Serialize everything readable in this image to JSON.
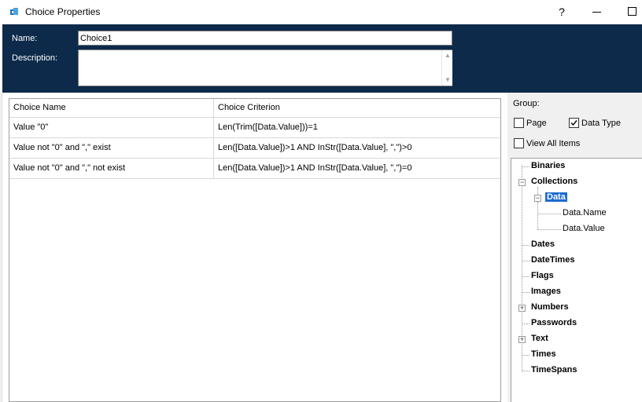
{
  "window": {
    "title": "Choice Properties",
    "help_glyph": "?",
    "icon": "app-icon"
  },
  "header": {
    "name_label": "Name:",
    "name_value": "Choice1",
    "description_label": "Description:",
    "description_value": "",
    "colors": {
      "panel_bg": "#0d2a4a"
    }
  },
  "grid": {
    "columns": [
      "Choice Name",
      "Choice Criterion"
    ],
    "rows": [
      {
        "name": "Value \"0\"",
        "criterion": "Len(Trim([Data.Value]))=1"
      },
      {
        "name": "Value not \"0\" and \",\" exist",
        "criterion": "Len([Data.Value])>1 AND InStr([Data.Value], \",\")>0"
      },
      {
        "name": "Value not \"0\" and \",\" not exist",
        "criterion": "Len([Data.Value])>1 AND InStr([Data.Value], \",\")=0"
      }
    ]
  },
  "group": {
    "label": "Group:",
    "page_label": "Page",
    "page_checked": false,
    "data_type_label": "Data Type",
    "data_type_checked": true,
    "view_all_label": "View All Items",
    "view_all_checked": false
  },
  "tree": {
    "items": [
      {
        "label": "Binaries"
      },
      {
        "label": "Collections",
        "expanded": true
      },
      {
        "label": "Data",
        "expanded": true,
        "selected": true
      },
      {
        "label": "Data.Name"
      },
      {
        "label": "Data.Value"
      },
      {
        "label": "Dates"
      },
      {
        "label": "DateTimes"
      },
      {
        "label": "Flags"
      },
      {
        "label": "Images"
      },
      {
        "label": "Numbers",
        "expanded": false
      },
      {
        "label": "Passwords"
      },
      {
        "label": "Text",
        "expanded": false
      },
      {
        "label": "Times"
      },
      {
        "label": "TimeSpans"
      }
    ],
    "colors": {
      "selection": "#1b6bd0"
    }
  }
}
